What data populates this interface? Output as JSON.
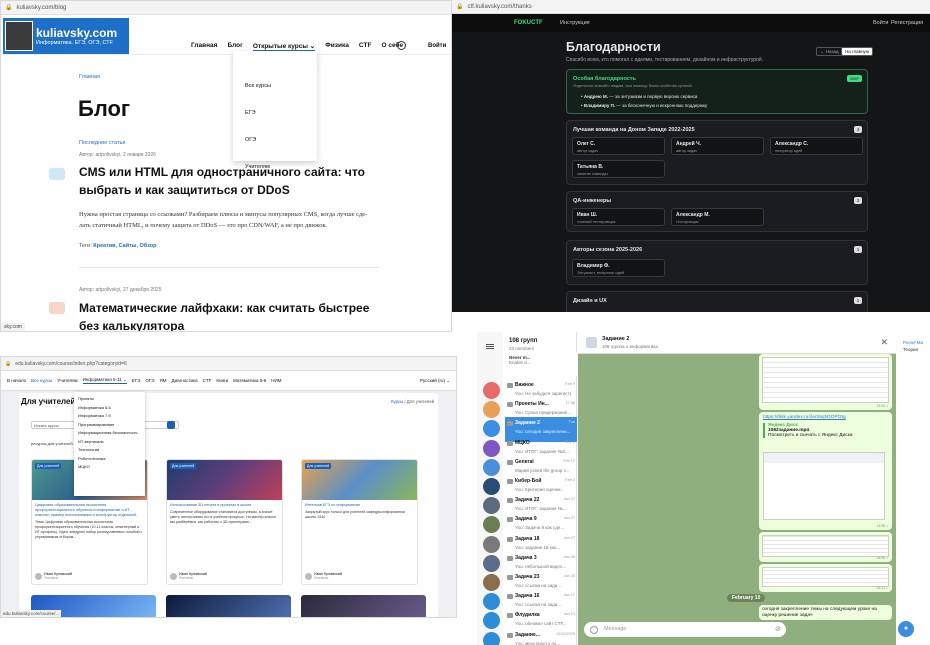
{
  "blog": {
    "url": "kuliavsky.com/blog",
    "logo_title": "kuliavsky.com",
    "logo_sub": "Информатика. ЕГЭ, ОГЭ, СТF",
    "nav": [
      "Главная",
      "Блог",
      "Открытые курсы ⌄",
      "Физика",
      "CTF",
      "О себе"
    ],
    "login": "Войти",
    "dropdown": [
      "Все курсы",
      "ЕГЭ",
      "ОГЭ",
      "Учителям"
    ],
    "breadcrumb": "Главная",
    "heading": "Блог",
    "section": "Последние статьи",
    "post1_meta": "Автор: artpolivskyi, 2 января 2026",
    "post1_title": "CMS или HTML для одностраничного сайта: что выбрать и как защититься от DDoS",
    "post1_excerpt": "Нужна простая страница со ссылками? Разбираем плюсы и минусы популярных CMS, когда лучше сде-лать статичный HTML, и почему защита от DDoS — это про CDN/WAF, а не про движок.",
    "post1_tags_label": "Теги:",
    "post1_tags": "Креатив, Сайты, Обзор",
    "post2_meta": "Автор: artpolivskyi, 27 декабря 2025",
    "post2_title": "Математические лайфхаки: как считать быстрее без калькулятора",
    "status": "sky.com"
  },
  "ctf": {
    "url": "ctf.kuliavsky.com/thanks",
    "brand": "FOKUCTF",
    "nav_instructions": "Инструкция",
    "login": "Войти",
    "register": "Регистрация",
    "heading": "Благодарности",
    "subtitle": "Спасибо всем, кто помогал с идеями, тестированием, дизайном и инфраструктурой.",
    "btn_back": "← Назад",
    "btn_home": "На главную",
    "special": {
      "title": "Особая благодарность",
      "desc": "Отдельное спасибо людям, чья помощь была особенно ценной.",
      "badge": "MVP",
      "items": [
        {
          "name": "Андрею М.",
          "text": " — за энтузиазм и первую версию сервиса"
        },
        {
          "name": "Владимиру П.",
          "text": " — за бесконечную и искреннюю поддержку"
        }
      ]
    },
    "team": {
      "title": "Лучшая команда на Доном Западе 2022-2025",
      "count": "4",
      "members": [
        {
          "name": "Олег С.",
          "role": "автор задач"
        },
        {
          "name": "Андрей Ч.",
          "role": "автор задач"
        },
        {
          "name": "Александр С.",
          "role": "генератор идей"
        },
        {
          "name": "Татьяна В.",
          "role": "капитан команды"
        }
      ]
    },
    "qa": {
      "title": "QA-инженеры",
      "count": "2",
      "members": [
        {
          "name": "Иван Ш.",
          "role": "главный тестировщик"
        },
        {
          "name": "Александр М.",
          "role": "тестировщик"
        }
      ]
    },
    "authors": {
      "title": "Авторы сезона 2025-2026",
      "count": "1",
      "members": [
        {
          "name": "Владимир Ф.",
          "role": "Энтузиаст, генератор идей"
        }
      ]
    },
    "design": {
      "title": "Дизайн и UX",
      "count": "1"
    }
  },
  "edu": {
    "url": "edu.kuliavsky.com/course/index.php?categoryid=6",
    "nav": [
      "В начало",
      "Все курсы",
      "Учителям",
      "Информатика 5-11 ⌄",
      "ЕГЭ",
      "ОГЭ",
      "ЯМ",
      "Диагностика",
      "CTF",
      "Книги",
      "Математика 5-6",
      "НИМ"
    ],
    "lang": "Русский (ru) ⌄",
    "heading": "Для учителей",
    "breadcrumb_link": "Курсы",
    "breadcrumb_cur": "Для учителей",
    "menu": [
      "Проекты",
      "Информатика 5-6",
      "Информатика 7-9",
      "Программирование",
      "Информационная безопасность",
      "ИТ-вертикаль",
      "Технологии",
      "Робототехника",
      "МЦКО"
    ],
    "search_placeholder": "Искать курсы",
    "note": "ресурсы для учителей",
    "cards": [
      {
        "tag": "Для учителей",
        "title": "Цифровая образовательная экосистема профориентационного обучения в информатике и ИТ-классах: пример использования и конструктор отдельной",
        "desc": "Тема: Цифровая образовательная экосистема профориентационного обучения (10-11 классы, инженерный и ИТ-профиль). Идея: внедрить набор разноуровневых пособий с управляемым отбором...",
        "author": "Иван Кулявский",
        "author_sub": "Учитель"
      },
      {
        "tag": "Для учителей",
        "title": "Использование 3D-печати в проектах в школе",
        "desc": "Современное оборудование становится доступным, а значит уметь использовать его в учебном процессе. На мастер-классе мы разберёмся, как работать с 3D-принтерами...",
        "author": "Иван Кулявский",
        "author_sub": "Учитель"
      },
      {
        "tag": "Для учителей",
        "title": "Интенсив ЕГЭ по информатике",
        "desc": "Закрытый курс только для учителей кафедры информатики школы 1440",
        "author": "Иван Кулявский",
        "author_sub": "Учитель"
      }
    ],
    "status": "edu.kuliavsky.com/course/..."
  },
  "tg": {
    "folder_title": "108 групп",
    "folder_sub": "23 members",
    "chats": [
      {
        "name": "Важное",
        "msg": "You: Не забудьте зарегистр...",
        "date": "Feb 9",
        "color": "#e86b6b"
      },
      {
        "name": "Проекты Ин...",
        "msg": "You: Срока придержания...",
        "date": "17:58",
        "color": "#e8a05b"
      },
      {
        "name": "Задание 2",
        "msg": "You: сегодня закреплени...",
        "date": "Tue",
        "color": "#3a8de0"
      },
      {
        "name": "МЦКО",
        "msg": "You: ИТОГ: задание №2...",
        "date": "Mar 2",
        "color": "#7e57c2"
      },
      {
        "name": "General",
        "msg": "Марий joined the group v...",
        "date": "Feb 17",
        "color": "#4a90d9"
      },
      {
        "name": "Кибер-Бой",
        "msg": "You: Критерии оценки...",
        "date": "Feb 2",
        "color": "#2a4d77"
      },
      {
        "name": "Задача 22",
        "msg": "You: ИТОГ: задание №...",
        "date": "Jan 27",
        "color": "#5a6b7e"
      },
      {
        "name": "Задача 9",
        "msg": "You: Задача 9 как сде...",
        "date": "Jan 27",
        "color": "#6b7d52"
      },
      {
        "name": "Задача 18",
        "msg": "You: задание 18 как...",
        "date": "Jan 27",
        "color": "#7a7a7a"
      },
      {
        "name": "Задача 3",
        "msg": "You: небольшой видео...",
        "date": "Jan 26",
        "color": "#5c6c8c"
      },
      {
        "name": "Задача 23",
        "msg": "You: ссылка на зада...",
        "date": "Jan 25",
        "color": "#8a6d4a"
      },
      {
        "name": "Задача 16",
        "msg": "You: ссылка на зада...",
        "date": "Jan 17",
        "color": "#2f8cd6"
      },
      {
        "name": "Флудилка",
        "msg": "You: обновил сайт CTF...",
        "date": "Jan 13",
        "color": "#2f8cd6"
      },
      {
        "name": "Задание...",
        "msg": "You: мега просто по...",
        "date": "12/10/2025",
        "color": "#2f8cd6"
      }
    ],
    "notice_title": "Never m...",
    "notice_text": "Enable d...",
    "chat_title": "Задание 2",
    "chat_sub": "108 группа 1 информатика",
    "link1": "https://disk.yandex.ru/i/arSsqN3OPf3Ig",
    "disk_source": "Яндекс Диск",
    "disk_file": "1082задание.mp4",
    "disk_desc": "Посмотреть и скачать с Яндекс Диска",
    "t1": "13:03 ✓",
    "t2": "13:58 ✓",
    "t3": "14:09 ✓",
    "t4": "14:21 ✓",
    "date_chip": "February 10",
    "last_msg": "сегодня закрепление темы на следующем уроке на оценку решение задач",
    "input_placeholder": "Message",
    "right_title": "Pionel Ma",
    "right_sub": "Теория"
  }
}
